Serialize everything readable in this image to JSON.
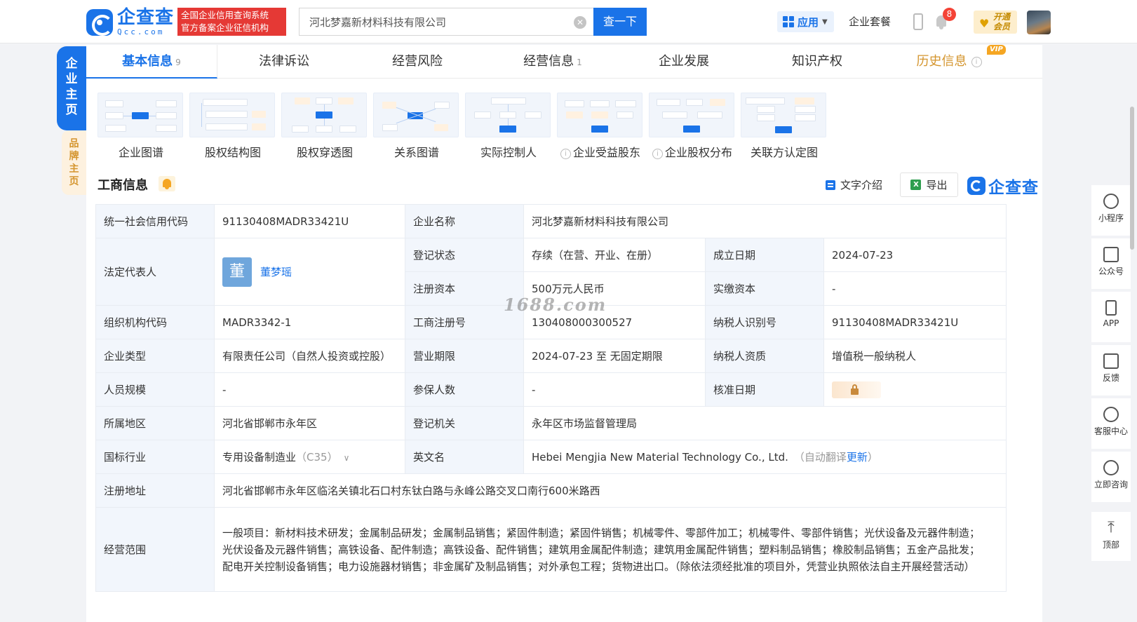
{
  "header": {
    "logo_cn": "企查查",
    "logo_en": "Qcc.com",
    "slogan_line1": "全国企业信用查询系统",
    "slogan_line2": "官方备案企业征信机构",
    "search_value": "河北梦嘉新材料科技有限公司",
    "search_button": "查一下",
    "apps_label": "应用",
    "suite_label": "企业套餐",
    "notification_count": "8",
    "vip_line1": "开通",
    "vip_line2": "会员"
  },
  "side_tabs": {
    "main": [
      "企",
      "业",
      "主",
      "页"
    ],
    "brand": [
      "品",
      "牌",
      "主",
      "页"
    ]
  },
  "tabs": [
    {
      "label": "基本信息",
      "count": "9"
    },
    {
      "label": "法律诉讼",
      "count": ""
    },
    {
      "label": "经营风险",
      "count": ""
    },
    {
      "label": "经营信息",
      "count": "1"
    },
    {
      "label": "企业发展",
      "count": ""
    },
    {
      "label": "知识产权",
      "count": ""
    },
    {
      "label": "历史信息",
      "count": ""
    }
  ],
  "vip_tag": "VIP",
  "graphs": [
    "企业图谱",
    "股权结构图",
    "股权穿透图",
    "关系图谱",
    "实际控制人",
    "企业受益股东",
    "企业股权分布",
    "关联方认定图"
  ],
  "section": {
    "title": "工商信息",
    "text_intro": "文字介绍",
    "export": "导出",
    "brand": "企查查"
  },
  "table": {
    "credit_code_label": "统一社会信用代码",
    "credit_code": "91130408MADR33421U",
    "company_name_label": "企业名称",
    "company_name": "河北梦嘉新材料科技有限公司",
    "legal_rep_label": "法定代表人",
    "legal_rep_char": "董",
    "legal_rep": "董梦瑶",
    "reg_status_label": "登记状态",
    "reg_status": "存续（在营、开业、在册）",
    "found_date_label": "成立日期",
    "found_date": "2024-07-23",
    "reg_capital_label": "注册资本",
    "reg_capital": "500万元人民币",
    "paid_capital_label": "实缴资本",
    "paid_capital": "-",
    "org_code_label": "组织机构代码",
    "org_code": "MADR3342-1",
    "reg_no_label": "工商注册号",
    "reg_no": "130408000300527",
    "taxpayer_id_label": "纳税人识别号",
    "taxpayer_id": "91130408MADR33421U",
    "company_type_label": "企业类型",
    "company_type": "有限责任公司（自然人投资或控股）",
    "term_label": "营业期限",
    "term": "2024-07-23 至 无固定期限",
    "tax_qual_label": "纳税人资质",
    "tax_qual": "增值税一般纳税人",
    "staff_label": "人员规模",
    "staff": "-",
    "insured_label": "参保人数",
    "insured": "-",
    "approve_date_label": "核准日期",
    "region_label": "所属地区",
    "region": "河北省邯郸市永年区",
    "authority_label": "登记机关",
    "authority": "永年区市场监督管理局",
    "industry_label": "国标行业",
    "industry": "专用设备制造业",
    "industry_code": "（C35）",
    "en_name_label": "英文名",
    "en_name": "Hebei Mengjia New Material Technology Co., Ltd.",
    "en_note_prefix": "（自动翻译",
    "en_note_link": "更新",
    "en_note_suffix": "）",
    "address_label": "注册地址",
    "address": "河北省邯郸市永年区临洺关镇北石口村东钛白路与永峰公路交叉口南行600米路西",
    "scope_label": "经营范围",
    "scope_line1": "一般项目：新材料技术研发；金属制品研发；金属制品销售；紧固件制造；紧固件销售；机械零件、零部件加工；机械零件、零部件销售；光伏设备及元器件制造；",
    "scope_line2": "光伏设备及元器件销售；高铁设备、配件制造；高铁设备、配件销售；建筑用金属配件制造；建筑用金属配件销售；塑料制品销售；橡胶制品销售；五金产品批发；",
    "scope_line3": "配电开关控制设备销售；电力设施器材销售；非金属矿及制品销售；对外承包工程；货物进出口。（除依法须经批准的项目外，凭营业执照依法自主开展经营活动）"
  },
  "watermark": "1688.com",
  "side_tools": [
    "小程序",
    "公众号",
    "APP",
    "反馈",
    "客服中心",
    "立即咨询",
    "顶部"
  ]
}
